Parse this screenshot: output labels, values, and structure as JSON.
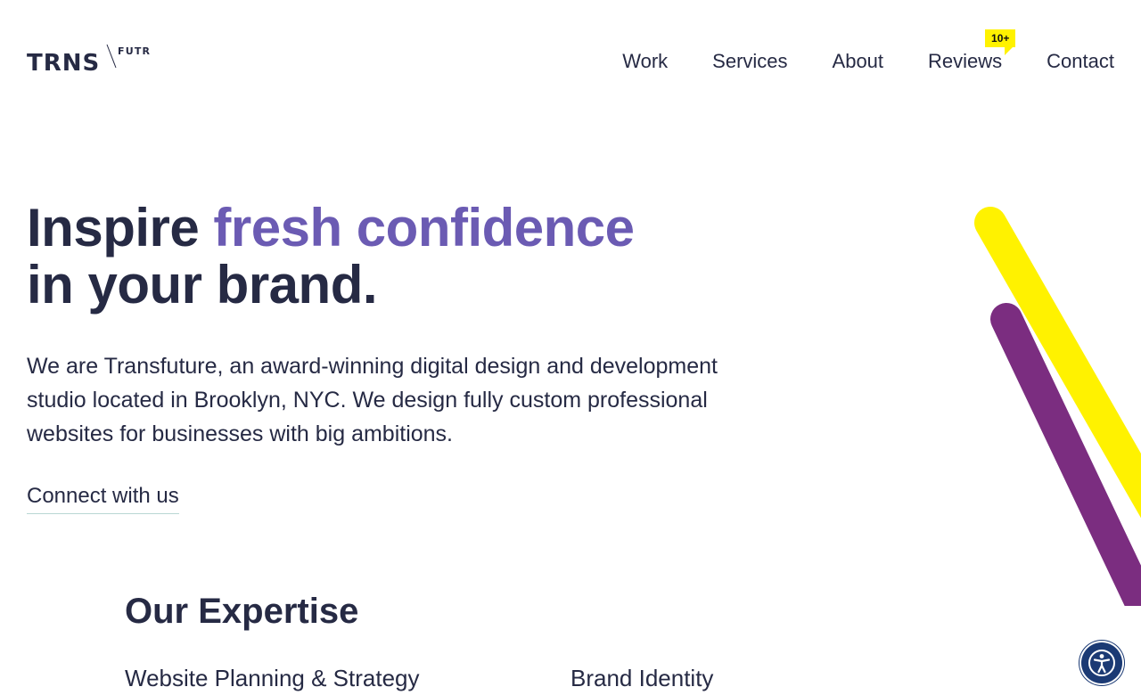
{
  "brand": {
    "logo_main": "TRNS",
    "logo_sub": "FUTR"
  },
  "nav": {
    "items": [
      {
        "label": "Work"
      },
      {
        "label": "Services"
      },
      {
        "label": "About"
      },
      {
        "label": "Reviews",
        "badge": "10+"
      },
      {
        "label": "Contact"
      }
    ]
  },
  "hero": {
    "title_part1": "Inspire ",
    "title_accent": "fresh confidence",
    "title_part2": "in your brand.",
    "description": "We are Transfuture, an award-winning digital design and development studio located in Brooklyn, NYC. We design fully custom professional websites for businesses with big ambitions.",
    "cta_label": "Connect with us"
  },
  "expertise": {
    "title": "Our Expertise",
    "items": [
      "Website Planning & Strategy",
      "Brand Identity"
    ]
  },
  "icons": {
    "accessibility": "accessibility-icon"
  },
  "colors": {
    "text": "#262a44",
    "accent": "#6b5bb3",
    "stripe_yellow": "#fff200",
    "stripe_purple": "#7b2d80",
    "badge": "#fff200",
    "a11y_button": "#1b3a74"
  }
}
